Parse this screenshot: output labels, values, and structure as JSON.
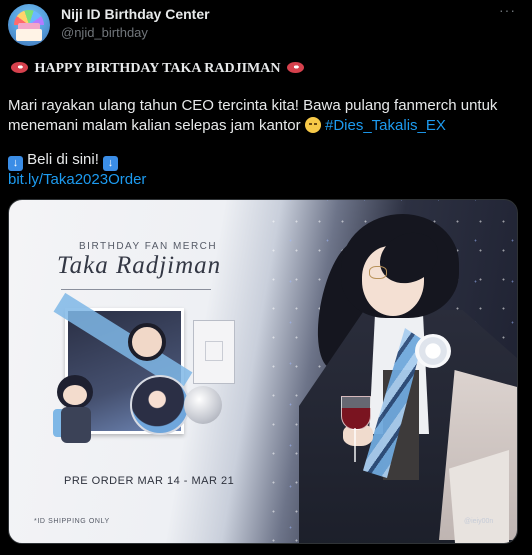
{
  "tweet": {
    "display_name": "Niji ID Birthday Center",
    "handle": "@njid_birthday",
    "more_label": "···",
    "heading": "HAPPY BIRTHDAY TAKA RADJIMAN",
    "body": "Mari rayakan ulang tahun CEO tercinta kita! Bawa pulang fanmerch untuk menemani malam kalian selepas jam kantor",
    "hashtag": "#Dies_Takalis_EX",
    "cta": "Beli di sini!",
    "link": "bit.ly/Taka2023Order"
  },
  "media": {
    "subtitle": "BIRTHDAY FAN MERCH",
    "title": "Taka Radjiman",
    "preorder": "PRE ORDER MAR 14 - MAR 21",
    "shipping": "*ID SHIPPING ONLY",
    "watermark": "@ieiy00n"
  },
  "icons": {
    "meat_emoji": "meat-on-bone-icon",
    "relieved_emoji": "relieved-face-icon",
    "down_arrow_emoji": "down-arrow-icon",
    "more": "more-dots-icon"
  },
  "colors": {
    "background": "#000000",
    "text": "#e7e9ea",
    "muted": "#71767b",
    "link": "#1d9bf0"
  }
}
